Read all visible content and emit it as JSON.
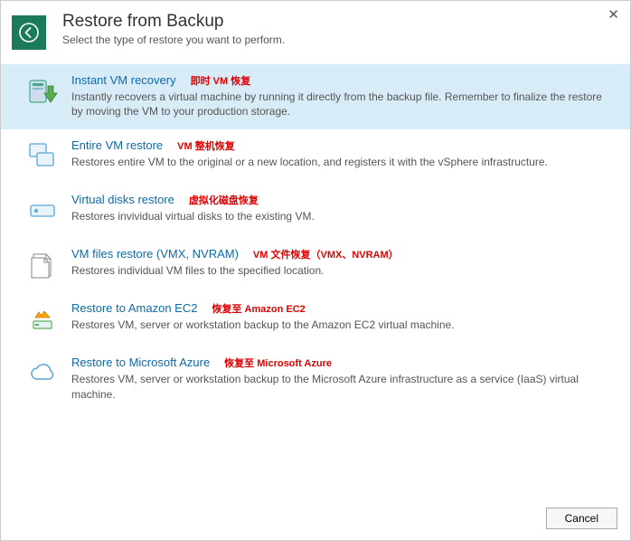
{
  "header": {
    "title": "Restore from Backup",
    "subtitle": "Select the type of restore you want to perform."
  },
  "options": [
    {
      "id": "instant-vm-recovery",
      "title": "Instant VM recovery",
      "annotation": "即时 VM 恢复",
      "desc": "Instantly recovers a virtual machine by running it directly from the backup file. Remember to finalize the restore by moving the VM to your production storage."
    },
    {
      "id": "entire-vm-restore",
      "title": "Entire VM restore",
      "annotation": "VM 整机恢复",
      "desc": "Restores entire VM to the original or a new location, and registers it with the vSphere infrastructure."
    },
    {
      "id": "virtual-disks-restore",
      "title": "Virtual disks restore",
      "annotation": "虚拟化磁盘恢复",
      "desc": "Restores invividual virtual disks to the existing VM."
    },
    {
      "id": "vm-files-restore",
      "title": "VM files restore (VMX, NVRAM)",
      "annotation": "VM 文件恢复（VMX、NVRAM）",
      "desc": "Restores individual VM files to the specified location."
    },
    {
      "id": "restore-amazon-ec2",
      "title": "Restore to Amazon EC2",
      "annotation": "恢复至 Amazon EC2",
      "desc": "Restores VM, server or workstation backup to the Amazon EC2 virtual machine."
    },
    {
      "id": "restore-azure",
      "title": "Restore to Microsoft Azure",
      "annotation": "恢复至 Microsoft Azure",
      "desc": "Restores VM, server or workstation backup to the Microsoft Azure infrastructure as a service (IaaS) virtual machine."
    }
  ],
  "footer": {
    "cancel": "Cancel"
  }
}
